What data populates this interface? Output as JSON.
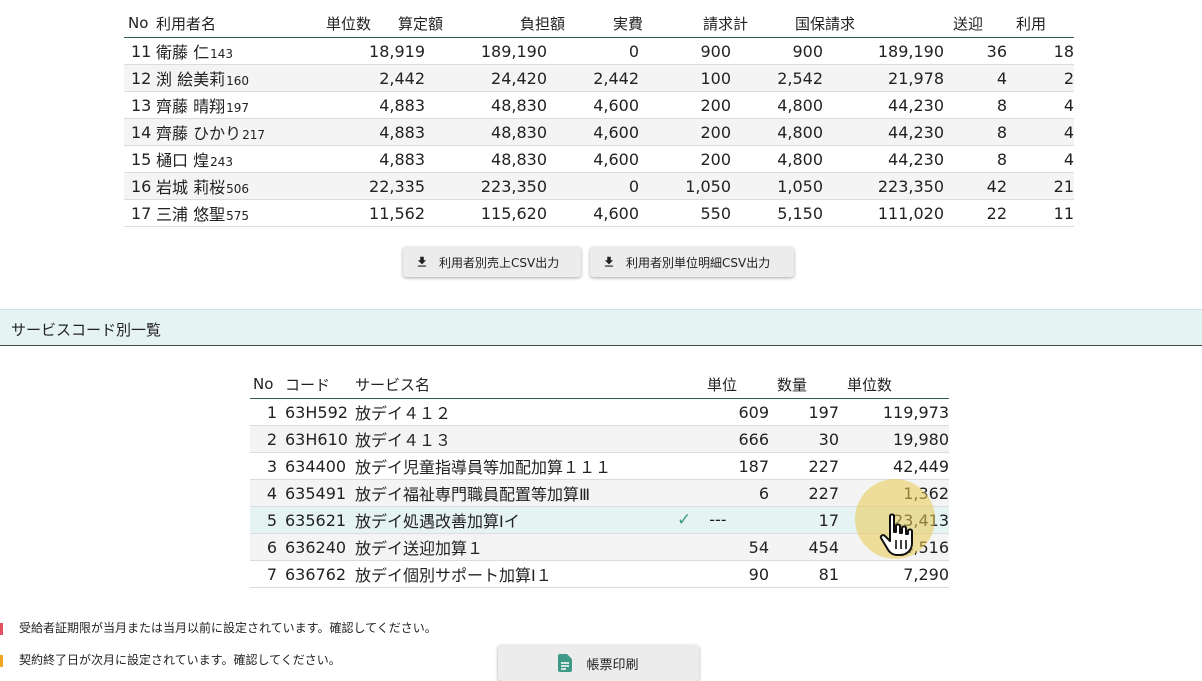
{
  "users": {
    "headers": [
      "No",
      "利用者名",
      "単位数",
      "算定額",
      "負担額",
      "実費",
      "請求計",
      "国保請求",
      "送迎",
      "利用"
    ],
    "rows": [
      {
        "no": "11",
        "name": "衛藤 仁",
        "uid": "143",
        "units": "18,919",
        "amount": "189,190",
        "burden": "0",
        "actual": "900",
        "total": "900",
        "kokuho": "189,190",
        "transport": "36",
        "use": "18"
      },
      {
        "no": "12",
        "name": "渕 絵美莉",
        "uid": "160",
        "units": "2,442",
        "amount": "24,420",
        "burden": "2,442",
        "actual": "100",
        "total": "2,542",
        "kokuho": "21,978",
        "transport": "4",
        "use": "2"
      },
      {
        "no": "13",
        "name": "齊藤 晴翔",
        "uid": "197",
        "units": "4,883",
        "amount": "48,830",
        "burden": "4,600",
        "actual": "200",
        "total": "4,800",
        "kokuho": "44,230",
        "transport": "8",
        "use": "4"
      },
      {
        "no": "14",
        "name": "齊藤 ひかり",
        "uid": "217",
        "units": "4,883",
        "amount": "48,830",
        "burden": "4,600",
        "actual": "200",
        "total": "4,800",
        "kokuho": "44,230",
        "transport": "8",
        "use": "4"
      },
      {
        "no": "15",
        "name": "樋口 煌",
        "uid": "243",
        "units": "4,883",
        "amount": "48,830",
        "burden": "4,600",
        "actual": "200",
        "total": "4,800",
        "kokuho": "44,230",
        "transport": "8",
        "use": "4"
      },
      {
        "no": "16",
        "name": "岩城 莉桜",
        "uid": "506",
        "units": "22,335",
        "amount": "223,350",
        "burden": "0",
        "actual": "1,050",
        "total": "1,050",
        "kokuho": "223,350",
        "transport": "42",
        "use": "21"
      },
      {
        "no": "17",
        "name": "三浦 悠聖",
        "uid": "575",
        "units": "11,562",
        "amount": "115,620",
        "burden": "4,600",
        "actual": "550",
        "total": "5,150",
        "kokuho": "111,020",
        "transport": "22",
        "use": "11"
      }
    ]
  },
  "buttons": {
    "csv_sales": "利用者別売上CSV出力",
    "csv_units": "利用者別単位明細CSV出力",
    "print": "帳票印刷"
  },
  "service_section": {
    "title": "サービスコード別一覧",
    "headers": [
      "No",
      "コード",
      "サービス名",
      "単位",
      "数量",
      "単位数"
    ],
    "rows": [
      {
        "no": "1",
        "code": "63H592",
        "name": "放デイ４１２",
        "unit": "609",
        "qty": "197",
        "units": "119,973"
      },
      {
        "no": "2",
        "code": "63H610",
        "name": "放デイ４１３",
        "unit": "666",
        "qty": "30",
        "units": "19,980"
      },
      {
        "no": "3",
        "code": "634400",
        "name": "放デイ児童指導員等加配加算１１１",
        "unit": "187",
        "qty": "227",
        "units": "42,449"
      },
      {
        "no": "4",
        "code": "635491",
        "name": "放デイ福祉専門職員配置等加算Ⅲ",
        "unit": "6",
        "qty": "227",
        "units": "1,362"
      },
      {
        "no": "5",
        "code": "635621",
        "name": "放デイ処遇改善加算Ⅰイ",
        "unit": "---",
        "qty": "17",
        "units": "23,413",
        "checked": true
      },
      {
        "no": "6",
        "code": "636240",
        "name": "放デイ送迎加算１",
        "unit": "54",
        "qty": "454",
        "units": "24,516"
      },
      {
        "no": "7",
        "code": "636762",
        "name": "放デイ個別サポート加算Ⅰ１",
        "unit": "90",
        "qty": "81",
        "units": "7,290"
      }
    ]
  },
  "warnings": [
    {
      "text": "受給者証期限が当月または当月以前に設定されています。確認してください。",
      "color": "#e2515f"
    },
    {
      "text": "契約終了日が次月に設定されています。確認してください。",
      "color": "#f0a623"
    }
  ],
  "colors": {
    "accent": "#2f5a55",
    "section_bg": "#e6f3f3",
    "check": "#3e9a86"
  }
}
